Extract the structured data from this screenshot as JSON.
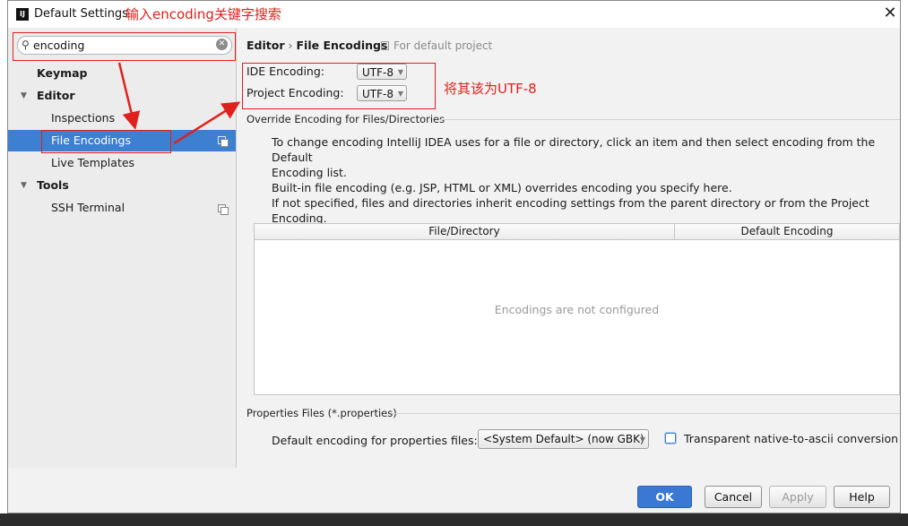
{
  "window": {
    "title": "Default Settings",
    "close": "✕"
  },
  "annotations": {
    "search_hint": "输入encoding关键字搜索",
    "change_hint": "将其该为UTF-8"
  },
  "sidebar": {
    "search": {
      "value": "encoding",
      "placeholder": ""
    },
    "items": [
      {
        "label": "Keymap"
      },
      {
        "label": "Editor"
      },
      {
        "label": "Inspections"
      },
      {
        "label": "File Encodings"
      },
      {
        "label": "Live Templates"
      },
      {
        "label": "Tools"
      },
      {
        "label": "SSH Terminal"
      }
    ]
  },
  "breadcrumb": {
    "parent": "Editor",
    "separator": "›",
    "current": "File Encodings",
    "note": "For default project"
  },
  "encodings": {
    "ide_label": "IDE Encoding:",
    "ide_value": "UTF-8",
    "project_label": "Project Encoding:",
    "project_value": "UTF-8"
  },
  "override_section": {
    "title": "Override Encoding for Files/Directories",
    "desc1_line1": "To change encoding IntelliJ IDEA uses for a file or directory, click an item and then select encoding from the Default",
    "desc1_line2": "Encoding list.",
    "desc2_line1": "Built-in file encoding (e.g. JSP, HTML or XML) overrides encoding you specify here.",
    "desc2_line2": "If not specified, files and directories inherit encoding settings from the parent directory or from the Project Encoding.",
    "columns": [
      "File/Directory",
      "Default Encoding"
    ],
    "empty_text": "Encodings are not configured"
  },
  "properties_section": {
    "title": "Properties Files (*.properties)",
    "default_label": "Default encoding for properties files:",
    "default_value": "<System Default> (now GBK)",
    "checkbox_label": "Transparent native-to-ascii conversion",
    "checkbox_checked": false
  },
  "buttons": {
    "ok": "OK",
    "cancel": "Cancel",
    "apply": "Apply",
    "help": "Help"
  }
}
